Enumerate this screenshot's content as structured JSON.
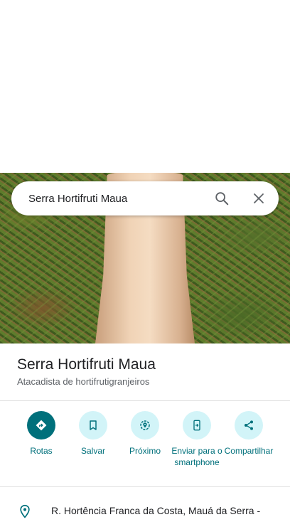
{
  "search": {
    "query": "Serra Hortifruti Maua"
  },
  "place": {
    "name": "Serra Hortifruti Maua",
    "category": "Atacadista de hortifrutigranjeiros"
  },
  "actions": [
    {
      "label": "Rotas",
      "icon": "directions-icon"
    },
    {
      "label": "Salvar",
      "icon": "bookmark-icon"
    },
    {
      "label": "Próximo",
      "icon": "nearby-icon"
    },
    {
      "label": "Enviar para o smartphone",
      "icon": "send-to-phone-icon"
    },
    {
      "label": "Compartilhar",
      "icon": "share-icon"
    }
  ],
  "address": {
    "text": "R. Hortência Franca da Costa, Mauá da Serra -"
  },
  "colors": {
    "accent": "#00707b",
    "accent_light": "#d2f4f8",
    "text_primary": "#202124",
    "text_secondary": "#5f6368"
  }
}
